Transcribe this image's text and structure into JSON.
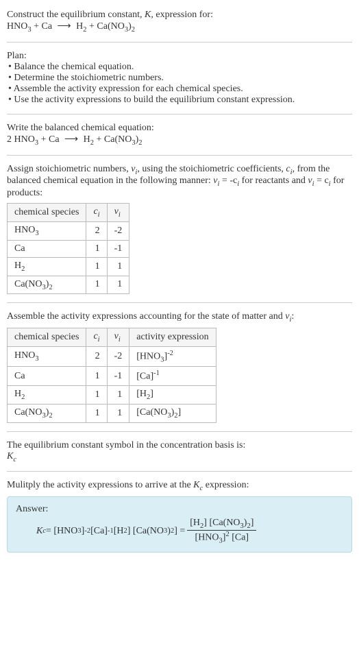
{
  "intro": {
    "line1": "Construct the equilibrium constant, ",
    "kvar": "K",
    "line1b": ", expression for:",
    "eq_left": "HNO",
    "eq_plus1": " + Ca",
    "arrow": "⟶",
    "eq_right1": "H",
    "eq_right2": " + Ca(NO",
    "eq_right3": ")"
  },
  "plan": {
    "title": "Plan:",
    "b1": "• Balance the chemical equation.",
    "b2": "• Determine the stoichiometric numbers.",
    "b3": "• Assemble the activity expression for each chemical species.",
    "b4": "• Use the activity expressions to build the equilibrium constant expression."
  },
  "balanced": {
    "title": "Write the balanced chemical equation:",
    "coef": "2 HNO",
    "plus1": " + Ca",
    "arrow": "⟶",
    "r1": "H",
    "r2": " + Ca(NO",
    "r3": ")"
  },
  "assign": {
    "line1a": "Assign stoichiometric numbers, ",
    "nu": "ν",
    "line1b": ", using the stoichiometric coefficients, ",
    "ci": "c",
    "line1c": ", from the balanced chemical equation in the following manner: ",
    "rel1a": "ν",
    "rel1b": " = -c",
    "rel1c": " for reactants and ",
    "rel2a": "ν",
    "rel2b": " = c",
    "rel2c": " for products:"
  },
  "table1": {
    "h1": "chemical species",
    "h2": "c",
    "h3": "ν",
    "rows": [
      {
        "sp": "HNO",
        "sub": "3",
        "c": "2",
        "v": "-2"
      },
      {
        "sp": "Ca",
        "sub": "",
        "c": "1",
        "v": "-1"
      },
      {
        "sp": "H",
        "sub": "2",
        "c": "1",
        "v": "1"
      },
      {
        "sp": "Ca(NO",
        "sub": "3",
        "sub2": "2",
        "close": ")",
        "c": "1",
        "v": "1"
      }
    ]
  },
  "assemble": {
    "title": "Assemble the activity expressions accounting for the state of matter and ",
    "nu": "ν",
    "colon": ":"
  },
  "table2": {
    "h1": "chemical species",
    "h2": "c",
    "h3": "ν",
    "h4": "activity expression",
    "rows": [
      {
        "sp": "HNO",
        "sub": "3",
        "c": "2",
        "v": "-2",
        "act_base": "[HNO",
        "act_sub": "3",
        "act_close": "]",
        "act_exp": "-2"
      },
      {
        "sp": "Ca",
        "sub": "",
        "c": "1",
        "v": "-1",
        "act_base": "[Ca]",
        "act_sub": "",
        "act_close": "",
        "act_exp": "-1"
      },
      {
        "sp": "H",
        "sub": "2",
        "c": "1",
        "v": "1",
        "act_base": "[H",
        "act_sub": "2",
        "act_close": "]",
        "act_exp": ""
      },
      {
        "sp": "Ca(NO",
        "sub": "3",
        "sub2": "2",
        "close": ")",
        "c": "1",
        "v": "1",
        "act_base": "[Ca(NO",
        "act_sub": "3",
        "act_mid": ")",
        "act_sub2": "2",
        "act_close": "]",
        "act_exp": ""
      }
    ]
  },
  "symbol": {
    "line": "The equilibrium constant symbol in the concentration basis is:",
    "kc": "K"
  },
  "multiply": {
    "line1": "Mulitply the activity expressions to arrive at the ",
    "kc": "K",
    "line2": " expression:"
  },
  "answer": {
    "label": "Answer:",
    "kc": "K",
    "eq": " = [HNO",
    "eq2": "]",
    "exp1": "-2",
    "eq3": " [Ca]",
    "exp2": "-1",
    "eq4": " [H",
    "eq5": "] [Ca(NO",
    "eq6": ")",
    "eq7": "] = ",
    "num": "[H",
    "num2": "] [Ca(NO",
    "num3": ")",
    "num4": "]",
    "den": "[HNO",
    "den2": "]",
    "denexp": "2",
    "den3": " [Ca]"
  }
}
